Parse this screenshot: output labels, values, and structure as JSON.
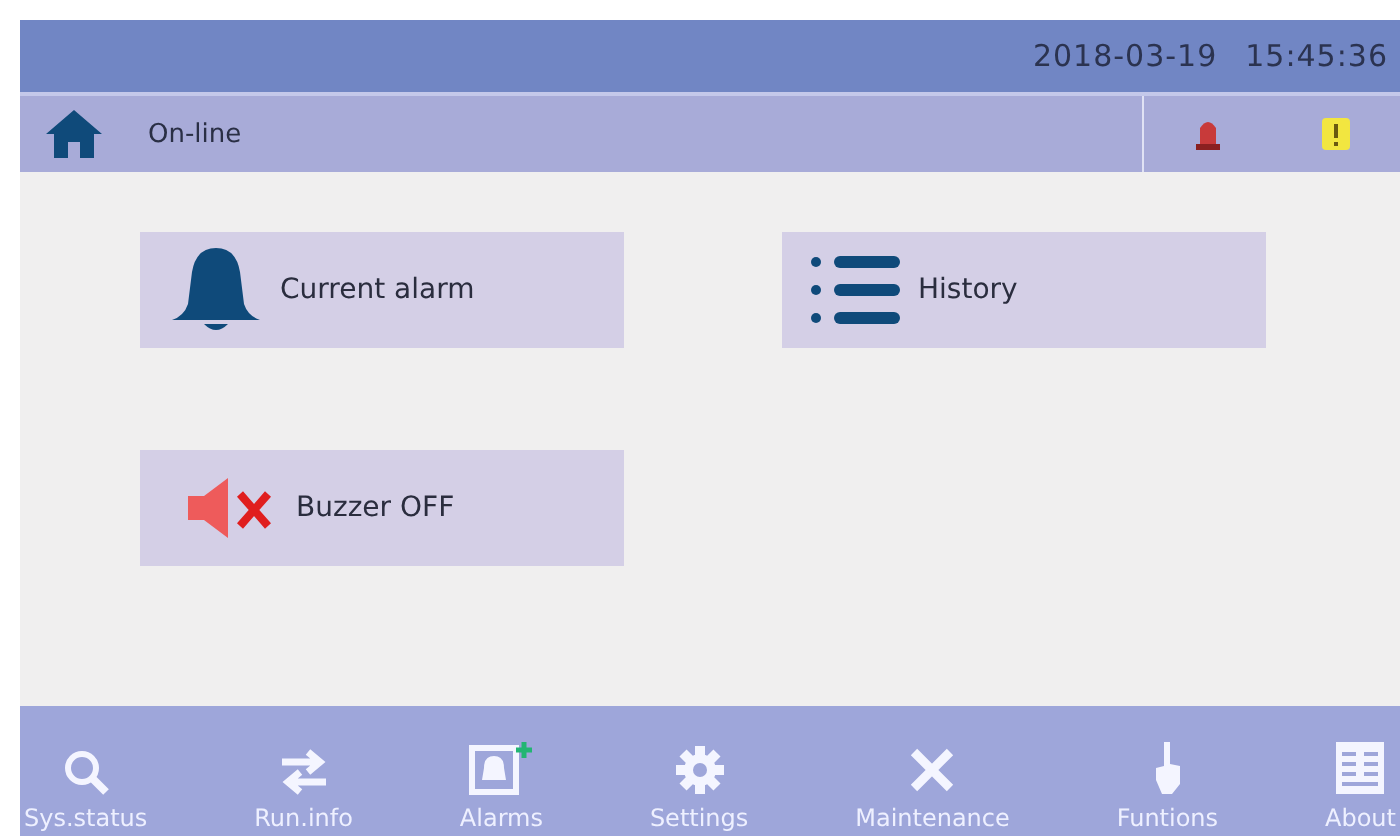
{
  "header": {
    "date": "2018-03-19",
    "time": "15:45:36"
  },
  "status_bar": {
    "state": "On-line"
  },
  "actions": [
    {
      "kind": "bell",
      "label": "Current alarm"
    },
    {
      "kind": "list",
      "label": "History"
    },
    {
      "kind": "mute",
      "label": "Buzzer OFF"
    }
  ],
  "nav": [
    {
      "kind": "status",
      "label": "Sys.status"
    },
    {
      "kind": "exchange",
      "label": "Run.info"
    },
    {
      "kind": "alarms",
      "label": "Alarms"
    },
    {
      "kind": "gear",
      "label": "Settings"
    },
    {
      "kind": "tools",
      "label": "Maintenance"
    },
    {
      "kind": "hand",
      "label": "Funtions"
    },
    {
      "kind": "about",
      "label": "About"
    }
  ]
}
